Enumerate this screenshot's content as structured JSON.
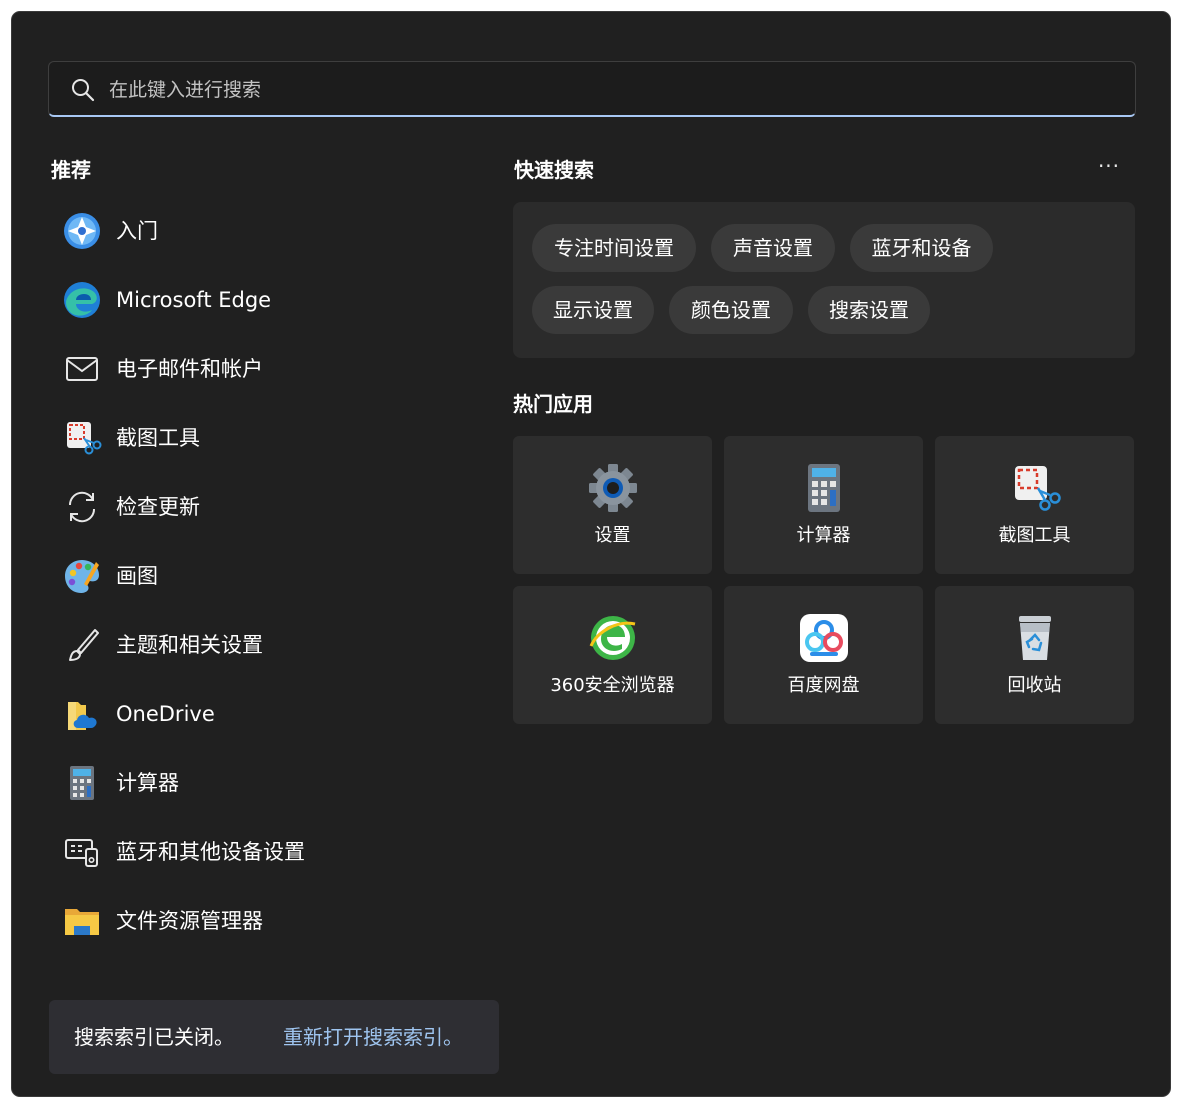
{
  "search": {
    "placeholder": "在此键入进行搜索"
  },
  "recommended": {
    "title": "推荐",
    "items": [
      {
        "label": "入门",
        "icon": "get-started-icon"
      },
      {
        "label": "Microsoft Edge",
        "icon": "edge-icon"
      },
      {
        "label": "电子邮件和帐户",
        "icon": "mail-icon"
      },
      {
        "label": "截图工具",
        "icon": "snipping-tool-icon"
      },
      {
        "label": "检查更新",
        "icon": "refresh-icon"
      },
      {
        "label": "画图",
        "icon": "paint-icon"
      },
      {
        "label": "主题和相关设置",
        "icon": "brush-icon"
      },
      {
        "label": "OneDrive",
        "icon": "onedrive-icon"
      },
      {
        "label": "计算器",
        "icon": "calculator-icon"
      },
      {
        "label": "蓝牙和其他设备设置",
        "icon": "devices-icon"
      },
      {
        "label": "文件资源管理器",
        "icon": "folder-icon"
      }
    ]
  },
  "quick_search": {
    "title": "快速搜索",
    "more": "···",
    "chips": [
      {
        "label": "专注时间设置"
      },
      {
        "label": "声音设置"
      },
      {
        "label": "蓝牙和设备"
      },
      {
        "label": "显示设置"
      },
      {
        "label": "颜色设置"
      },
      {
        "label": "搜索设置"
      }
    ]
  },
  "top_apps": {
    "title": "热门应用",
    "tiles": [
      {
        "label": "设置",
        "icon": "settings-gear-icon"
      },
      {
        "label": "计算器",
        "icon": "calculator-icon"
      },
      {
        "label": "截图工具",
        "icon": "snipping-tool-icon"
      },
      {
        "label": "360安全浏览器",
        "icon": "360-browser-icon"
      },
      {
        "label": "百度网盘",
        "icon": "baidu-netdisk-icon"
      },
      {
        "label": "回收站",
        "icon": "recycle-bin-icon"
      }
    ]
  },
  "index_notice": {
    "status": "搜索索引已关闭。",
    "link": "重新打开搜索索引。"
  },
  "colors": {
    "background": "#202020",
    "accent": "#a8c8f4",
    "link": "#9fc5f0"
  }
}
